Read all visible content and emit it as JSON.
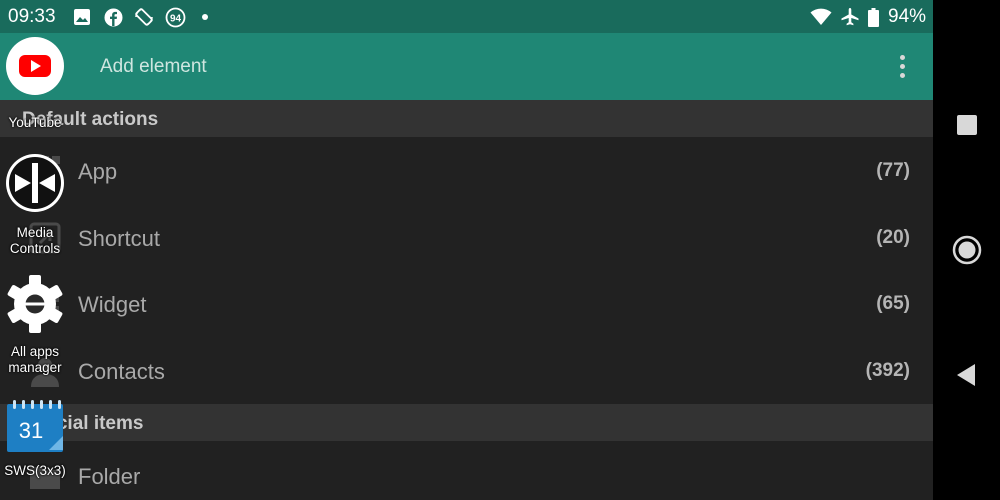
{
  "status_bar": {
    "time": "09:33",
    "battery_percent": "94%",
    "notification_badge": "94",
    "icons": [
      "image-icon",
      "facebook-icon",
      "rotation-lock-icon",
      "badge-94-icon",
      "dot-icon",
      "wifi-icon",
      "airplane-icon",
      "battery-icon"
    ]
  },
  "app_bar": {
    "title": "Add element"
  },
  "sections": [
    {
      "header": "Default actions",
      "items": [
        {
          "label": "App",
          "count": "(77)",
          "icon": "app-grid-icon"
        },
        {
          "label": "Shortcut",
          "count": "(20)",
          "icon": "shortcut-icon"
        },
        {
          "label": "Widget",
          "count": "(65)",
          "icon": "widget-icon"
        },
        {
          "label": "Contacts",
          "count": "(392)",
          "icon": "contact-icon"
        }
      ]
    },
    {
      "header": "Special items",
      "items": [
        {
          "label": "Folder",
          "count": "",
          "icon": "folder-icon"
        }
      ]
    }
  ],
  "floating_apps": [
    {
      "label": "YouTube",
      "icon": "youtube-icon"
    },
    {
      "label": "Media Controls",
      "icon": "media-controls-icon"
    },
    {
      "label": "All apps manager",
      "icon": "settings-gear-icon"
    },
    {
      "label": "SWS(3x3)",
      "icon": "calendar-31-icon"
    }
  ],
  "nav_bar": {
    "buttons": [
      "recents-button",
      "home-button",
      "back-button"
    ]
  },
  "colors": {
    "status_bar": "#196b5c",
    "app_bar": "#1f8775",
    "list_bg": "#212121",
    "section_header_bg": "#333333",
    "text_primary": "#a9a9a9",
    "youtube_red": "#ff0000",
    "calendar_blue": "#1e7fc4"
  }
}
